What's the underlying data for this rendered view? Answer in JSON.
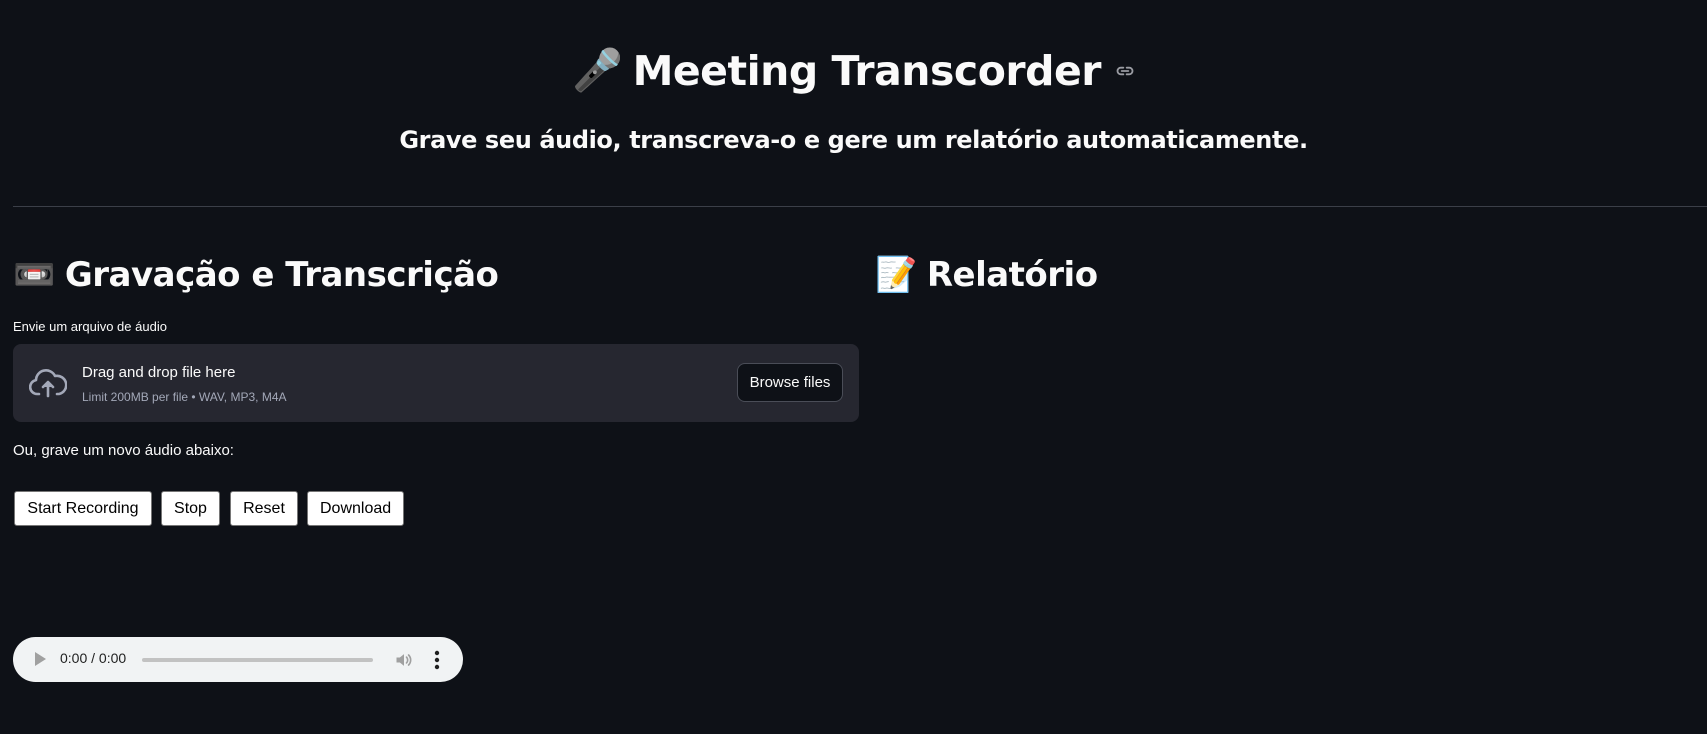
{
  "header": {
    "title_emoji": "🎤",
    "title": "Meeting Transcorder",
    "subtitle": "Grave seu áudio, transcreva-o e gere um relatório automaticamente."
  },
  "left_section": {
    "emoji": "📼",
    "heading": "Gravação e Transcrição",
    "upload_label": "Envie um arquivo de áudio",
    "dropzone": {
      "main_text": "Drag and drop file here",
      "sub_text": "Limit 200MB per file • WAV, MP3, M4A",
      "browse_label": "Browse files",
      "icon": "cloud-upload-icon"
    },
    "record_label": "Ou, grave um novo áudio abaixo:",
    "buttons": {
      "start": "Start Recording",
      "stop": "Stop",
      "reset": "Reset",
      "download": "Download"
    },
    "audio_player": {
      "time": "0:00 / 0:00",
      "progress": 0
    }
  },
  "right_section": {
    "emoji": "📝",
    "heading": "Relatório"
  },
  "colors": {
    "background": "#0e1117",
    "text": "#fafafa",
    "dropzone_bg": "#262730",
    "muted_text": "#a3a8b8"
  }
}
